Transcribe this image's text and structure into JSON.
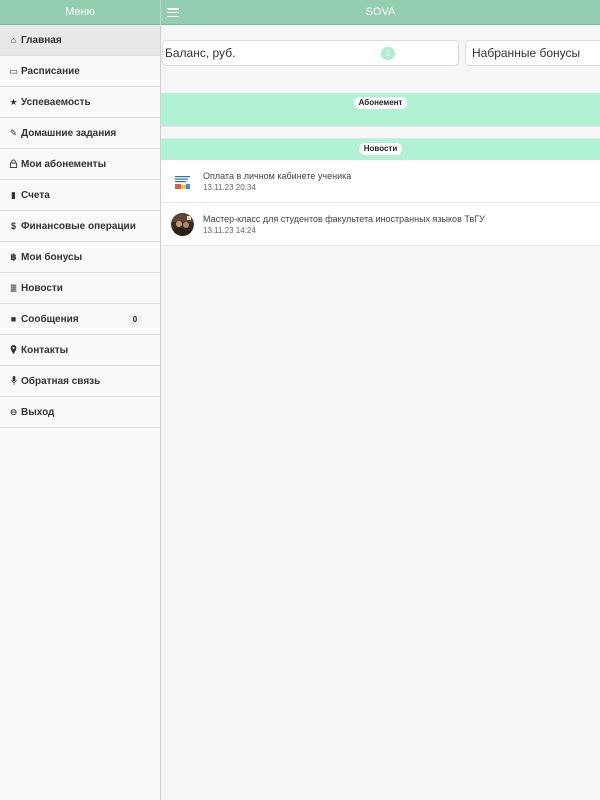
{
  "sidebar": {
    "title": "Меню",
    "items": [
      {
        "icon": "home-icon",
        "glyph": "⌂",
        "label": "Главная",
        "active": true
      },
      {
        "icon": "calendar-icon",
        "glyph": "▭",
        "label": "Расписание"
      },
      {
        "icon": "star-icon",
        "glyph": "★",
        "label": "Успеваемость"
      },
      {
        "icon": "edit-icon",
        "glyph": "✎",
        "label": "Домашние задания"
      },
      {
        "icon": "lock-icon",
        "glyph": "⌂",
        "label": "Мои абонементы"
      },
      {
        "icon": "receipt-icon",
        "glyph": "▮",
        "label": "Счета"
      },
      {
        "icon": "dollar-icon",
        "glyph": "$",
        "label": "Финансовые операции"
      },
      {
        "icon": "bitcoin-icon",
        "glyph": "฿",
        "label": "Мои бонусы"
      },
      {
        "icon": "list-icon",
        "glyph": "≣",
        "label": "Новости"
      },
      {
        "icon": "message-icon",
        "glyph": "■",
        "label": "Сообщения",
        "badge": "0"
      },
      {
        "icon": "location-icon",
        "glyph": "♦",
        "label": "Контакты"
      },
      {
        "icon": "microphone-icon",
        "glyph": "▮",
        "label": "Обратная связь"
      },
      {
        "icon": "logout-icon",
        "glyph": "⊖",
        "label": "Выход"
      }
    ]
  },
  "header": {
    "title": "SOVA",
    "menu_icon": "hamburger-icon"
  },
  "cards": {
    "balance_label": "Баланс, руб.",
    "balance_value": "0",
    "bonus_label": "Набранные бонусы"
  },
  "sections": {
    "subscription_label": "Абонемент",
    "news_label": "Новости"
  },
  "news": [
    {
      "title": "Оплата в личном кабинете ученика",
      "date": "13.11.23 20:34",
      "thumb": "payment-thumb-icon"
    },
    {
      "title": "Мастер-класс для студентов факультета иностранных языков ТвГУ",
      "date": "13.11.23 14:24",
      "thumb": "masterclass-thumb-icon"
    }
  ],
  "colors": {
    "accent": "#93ceb0",
    "section_bg": "#b0f2d3",
    "badge_bg": "#b0ecd0"
  }
}
